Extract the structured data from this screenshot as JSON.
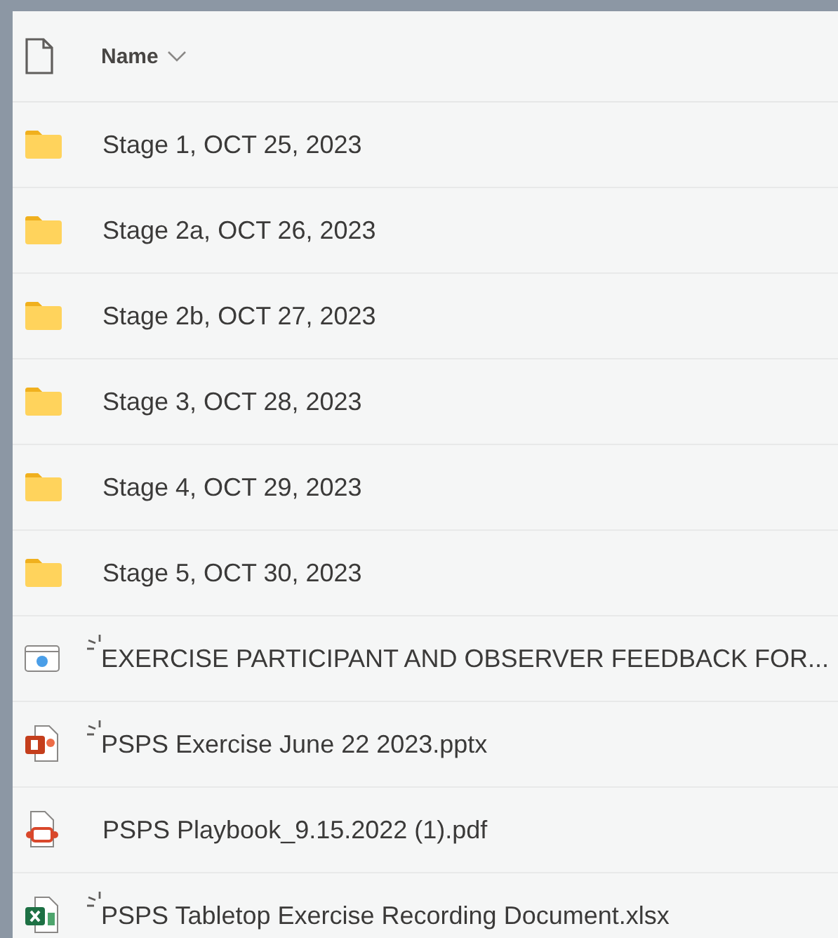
{
  "header": {
    "column": "Name",
    "sorted": true
  },
  "files": [
    {
      "kind": "folder",
      "name": "Stage 1, OCT 25, 2023",
      "new": false
    },
    {
      "kind": "folder",
      "name": "Stage 2a, OCT 26, 2023",
      "new": false
    },
    {
      "kind": "folder",
      "name": "Stage 2b, OCT 27, 2023",
      "new": false
    },
    {
      "kind": "folder",
      "name": "Stage 3, OCT 28, 2023",
      "new": false
    },
    {
      "kind": "folder",
      "name": "Stage 4, OCT 29, 2023",
      "new": false
    },
    {
      "kind": "folder",
      "name": "Stage 5, OCT 30, 2023",
      "new": false
    },
    {
      "kind": "web",
      "name": "EXERCISE PARTICIPANT AND OBSERVER FEEDBACK FOR...",
      "new": true
    },
    {
      "kind": "slides",
      "name": "PSPS Exercise June 22 2023.pptx",
      "new": true
    },
    {
      "kind": "pdf",
      "name": "PSPS Playbook_9.15.2022 (1).pdf",
      "new": false
    },
    {
      "kind": "sheet",
      "name": "PSPS Tabletop Exercise Recording Document.xlsx",
      "new": true
    }
  ]
}
